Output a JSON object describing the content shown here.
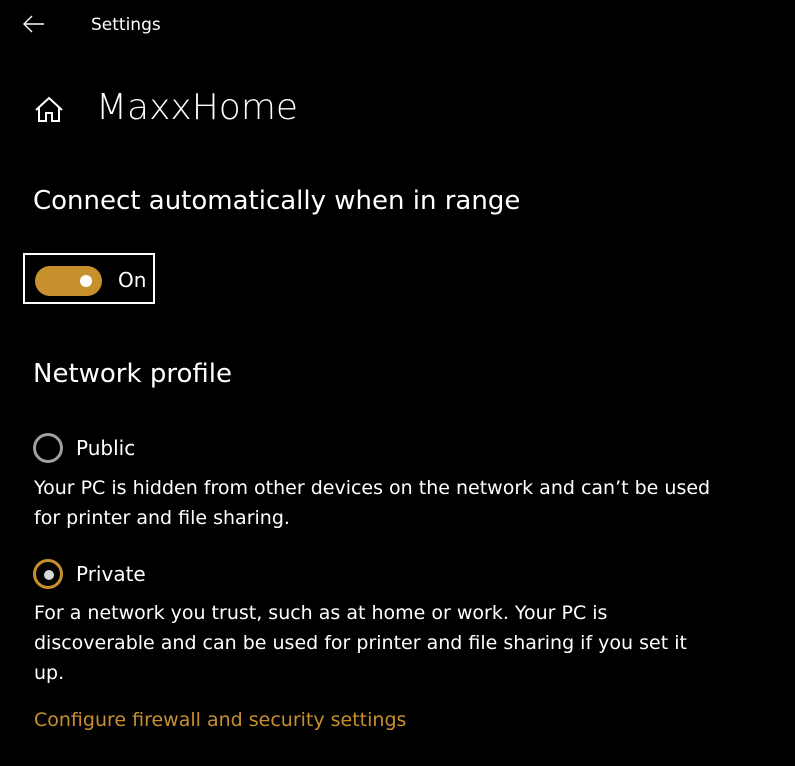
{
  "window": {
    "title": "Settings"
  },
  "icons": {
    "back": "back-arrow-icon",
    "home": "home-icon"
  },
  "header": {
    "title": "MaxxHome"
  },
  "connect_auto": {
    "heading": "Connect automatically when in range",
    "toggle_state": "On",
    "is_on": true
  },
  "network_profile": {
    "heading": "Network profile",
    "options": [
      {
        "label": "Public",
        "selected": false,
        "description": "Your PC is hidden from other devices on the network and can’t be used for printer and file sharing."
      },
      {
        "label": "Private",
        "selected": true,
        "description": "For a network you trust, such as at home or work. Your PC is discoverable and can be used for printer and file sharing if you set it up."
      }
    ]
  },
  "link": {
    "label": "Configure firewall and security settings"
  },
  "colors": {
    "background": "#000000",
    "text": "#ffffff",
    "accent": "#c8902d",
    "radio_border": "#a0a0a0",
    "radio_dot": "#d8d8d8"
  }
}
